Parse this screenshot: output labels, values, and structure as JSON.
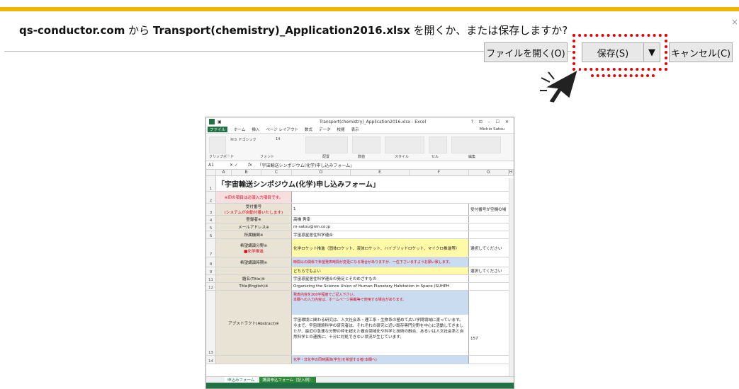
{
  "notification": {
    "site": "qs-conductor.com",
    "from": " から ",
    "filename": "Transport(chemistry)_Application2016.xlsx",
    "question": " を開くか、または保存しますか?",
    "close": "×"
  },
  "buttons": {
    "open": "ファイルを開く(O)",
    "save": "保存(S)",
    "dropdown": "▼",
    "cancel": "キャンセル(C)"
  },
  "colors": {
    "accent": "#f0b300",
    "highlight": "#e60000",
    "excel_green": "#217346"
  },
  "excel": {
    "window_title": "Transport(chemistry)_Application2016.xlsx - Excel",
    "window_buttons": "? ⊡ – ☐ ✕",
    "tabs": [
      "ファイル",
      "ホーム",
      "挿入",
      "ページ レイアウト",
      "数式",
      "データ",
      "校閲",
      "表示"
    ],
    "user": "Michio Satou",
    "ribbon_groups": [
      "クリップボード",
      "フォント",
      "配置",
      "数値",
      "スタイル",
      "セル",
      "編集"
    ],
    "font_name": "ＭＳ Ｐゴシック",
    "font_size": "14",
    "cell_ref": "A1",
    "formula": "「宇宙輸送シンポジウム(化学)申し込みフォーム」",
    "columns": [
      "A",
      "B",
      "C",
      "D",
      "E",
      "F",
      "G",
      "H"
    ],
    "rows": [
      {
        "n": "1",
        "label": "",
        "value": "「宇宙輸送シンポジウム(化学)申し込みフォーム」",
        "note": ""
      },
      {
        "n": "2",
        "label": "※印の項目は必須入力項目です。",
        "value": "",
        "note": ""
      },
      {
        "n": "3",
        "label": "受付番号",
        "label2": "(システムが自動付番いたします)",
        "value": "1",
        "note": "受付番号が空欄の場"
      },
      {
        "n": "4",
        "label": "登録者※",
        "value": "高橋 秀幸",
        "note": ""
      },
      {
        "n": "5",
        "label": "メールアドレス※",
        "value": "m-satou@nin.co.jp",
        "note": ""
      },
      {
        "n": "6",
        "label": "所属機関※",
        "value": "宇宙惑星居住科学連合",
        "note": ""
      },
      {
        "n": "7",
        "label": "希望講演分野※",
        "label2": "■化学推進",
        "value": "化学ロケット推進（固体ロケット、液体ロケット、ハイブリッドロケット、マイクロ推進等）",
        "note": "選択してください"
      },
      {
        "n": "8",
        "label": "希望講演時期※",
        "value": "時間以の関係で希望発表時間が変更になる場合がありますが、一任下さいますようお願い致します。",
        "note": ""
      },
      {
        "n": "9",
        "label": "",
        "value": "どちらでもよい",
        "note": "選択してください"
      },
      {
        "n": "11",
        "label": "題名(Title)※",
        "value": "宇宙惑星居住科学連合の発足とそのめざすもの",
        "note": ""
      },
      {
        "n": "12",
        "label": "Title(English)※",
        "value": "Organizing the Science Union of Human Planetary Habitation in Space (SUHPH",
        "note": ""
      },
      {
        "n": "13",
        "label": "アブストラクト(Abstract)※",
        "value": "発表内容を200字程度でご記入下さい。",
        "value2": "本欄への入力内容は、ホームページ掲載等で使用する場合があります。",
        "value3": "宇宙環境に関わる研究は、人文社会系・理工系・生物系の極めて広い学問領域に渡っています。今まで、宇宙環境科学の研究者は、それぞれの研究に近い既存専門分野を中心に活動してきましたが、最近の急速な分野の枠を超えた複合領域化や科学と技術の融合、あるいは人文社会系と自然科学との連携に、十分に対処できない状況が生じています。",
        "note": "157"
      },
      {
        "n": "14",
        "label": "",
        "value": "化学・非化学の同時講演(学生)を希望する者(本欄へ)",
        "note": ""
      }
    ],
    "sheets": [
      "申込みフォーム",
      "講演申込フォーム（記入例）"
    ]
  }
}
